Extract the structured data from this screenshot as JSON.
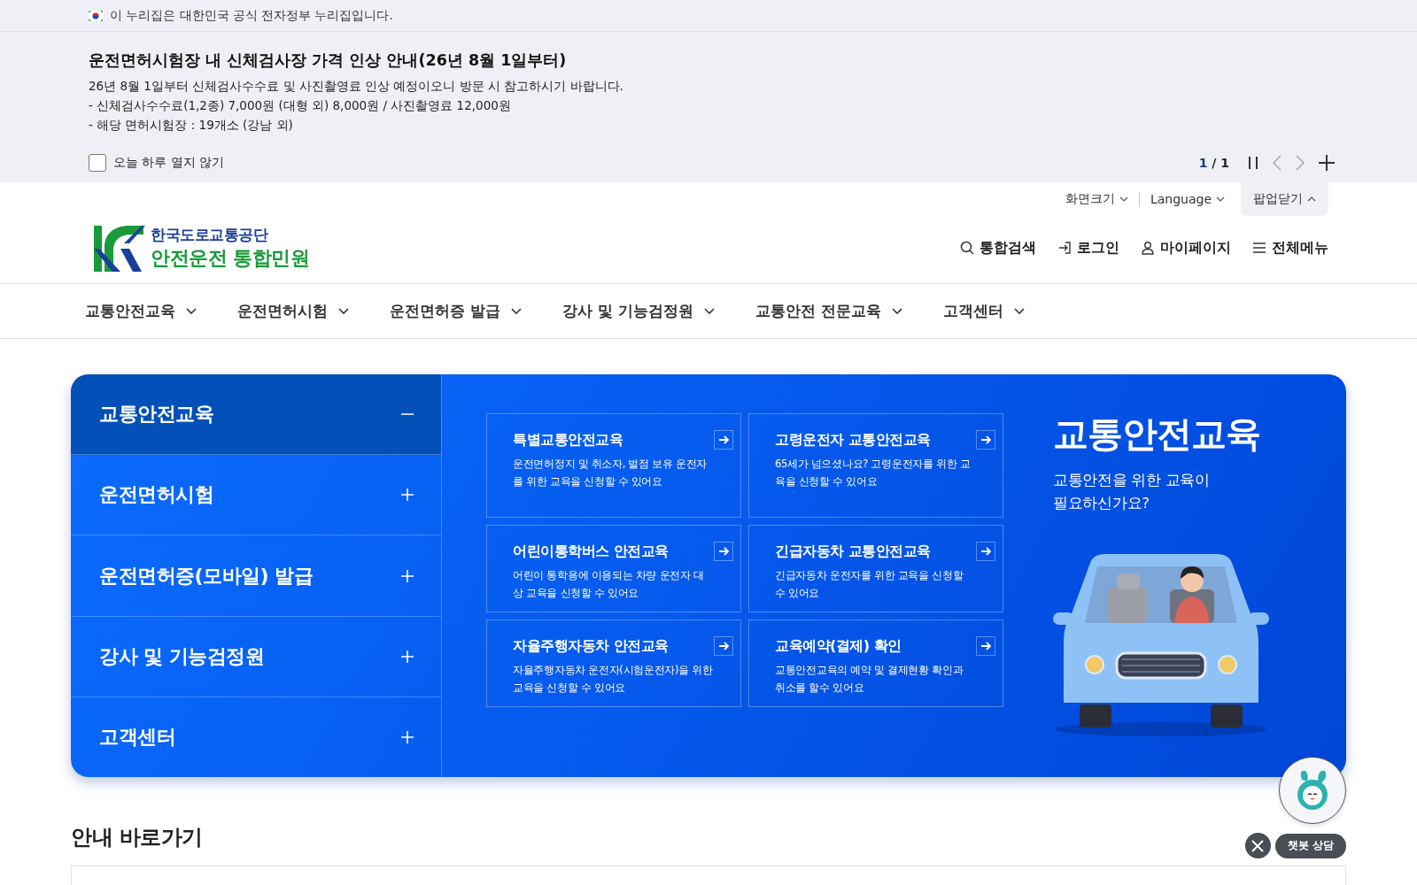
{
  "gov_banner": {
    "text": "이 누리집은 대한민국 공식 전자정부 누리집입니다."
  },
  "popup": {
    "title": "운전면허시험장 내 신체검사장 가격 인상 안내(26년 8월 1일부터)",
    "lines": [
      "26년 8월 1일부터 신체검사수수료 및 사진촬영료 인상 예정이오니 방문 시 참고하시기 바랍니다.",
      "- 신체검사수수료(1,2종) 7,000원 (대형 외) 8,000원 / 사진촬영료 12,000원",
      "- 해당 면허시험장 : 19개소 (강남 외)"
    ],
    "dont_show": {
      "label": "오늘 하루 열지 않기",
      "checked": false
    },
    "pager": {
      "current": "1",
      "separator": "/",
      "total": "1"
    }
  },
  "utility": {
    "font_size": "화면크기",
    "language": "Language",
    "popup_toggle": {
      "label": "팝업닫기",
      "expanded": true
    }
  },
  "logo": {
    "org": "한국도로교통공단",
    "service": "안전운전 통합민원"
  },
  "header_actions": [
    {
      "kind": "search",
      "label": "통합검색"
    },
    {
      "kind": "login",
      "label": "로그인"
    },
    {
      "kind": "mypage",
      "label": "마이페이지"
    },
    {
      "kind": "menu",
      "label": "전체메뉴"
    }
  ],
  "nav": [
    "교통안전교육",
    "운전면허시험",
    "운전면허증 발급",
    "강사 및 기능검정원",
    "교통안전 전문교육",
    "고객센터"
  ],
  "hero": {
    "sidebar": [
      {
        "label": "교통안전교육",
        "expanded": true
      },
      {
        "label": "운전면허시험",
        "expanded": false
      },
      {
        "label": "운전면허증(모바일) 발급",
        "expanded": false
      },
      {
        "label": "강사 및 기능검정원",
        "expanded": false
      },
      {
        "label": "고객센터",
        "expanded": false
      }
    ],
    "cards": [
      {
        "title": "특별교통안전교육",
        "description": "운전면허정지 및 취소자, 벌점 보유 운전자를 위한 교육을 신청할 수 있어요"
      },
      {
        "title": "고령운전자 교통안전교육",
        "description": "65세가 넘으셨나요? 고령운전자를 위한 교육을 신청할 수 있어요"
      },
      {
        "title": "어린이통학버스 안전교육",
        "description": "어린이 통학용에 이용되는 차량 운전자 대상 교육을 신청할 수 있어요"
      },
      {
        "title": "긴급자동차 교통안전교육",
        "description": "긴급자동차 운전자를 위한 교육을 신청할 수 있어요"
      },
      {
        "title": "자율주행자동차 안전교육",
        "description": "자율주행자동차 운전자(시험운전자)을 위한 교육을 신청할 수 있어요"
      },
      {
        "title": "교육예약(결제) 확인",
        "description": "교통안전교육의 예약 및 결제현황 확인과 취소를 할수 있어요"
      }
    ],
    "promo": {
      "title": "교통안전교육",
      "subtitle": "교통안전을 위한 교육이\n필요하신가요?"
    }
  },
  "chatbot": {
    "label": "챗봇 상담"
  },
  "section_heading": "안내 바로가기"
}
